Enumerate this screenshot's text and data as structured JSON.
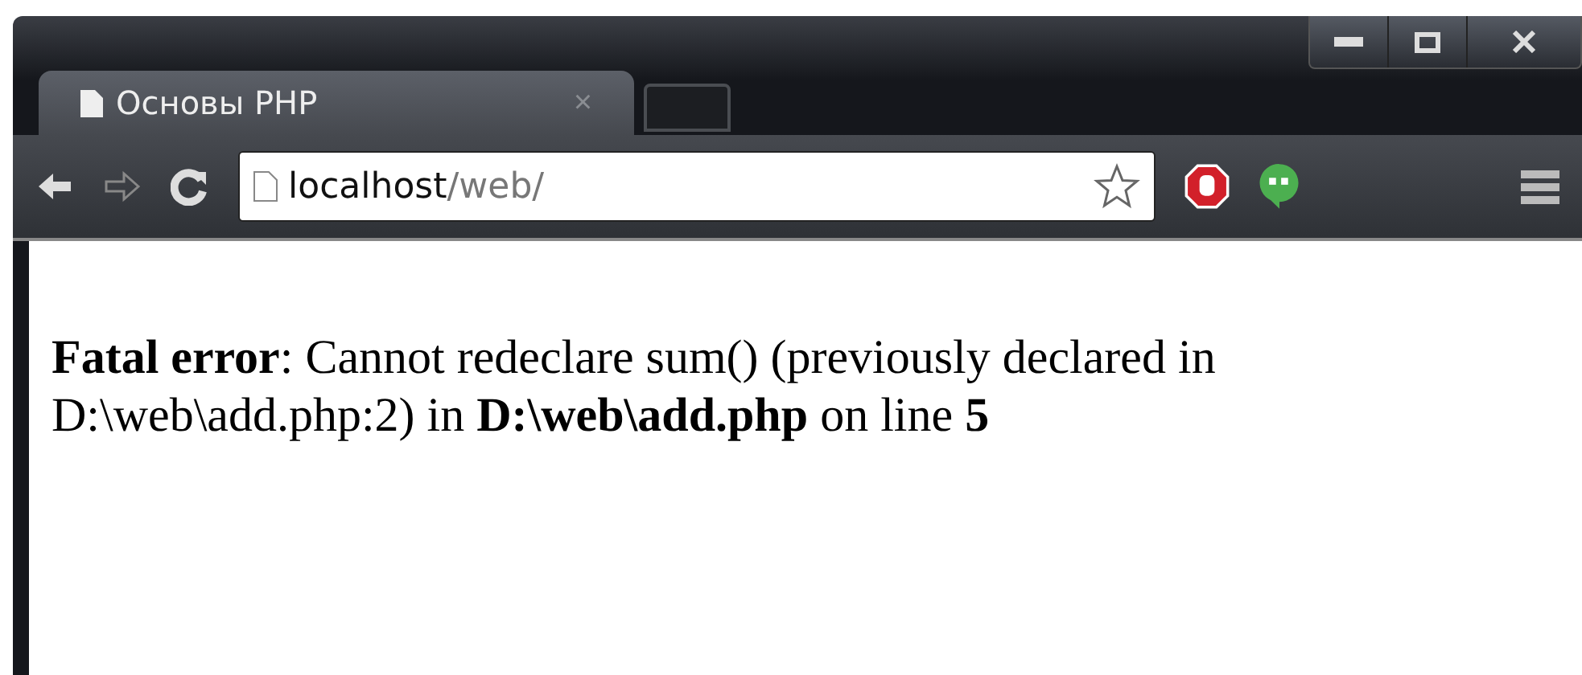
{
  "tabs": [
    {
      "title": "Основы PHP",
      "close": "×",
      "selected": true
    }
  ],
  "address_bar": {
    "host": "localhost",
    "path": "/web/"
  },
  "page": {
    "message": "**Fatal error**: Cannot redeclare sum() (previously declared in D:\\web\\add.php:2) in **D:\\web\\add.php** on line **5**"
  }
}
